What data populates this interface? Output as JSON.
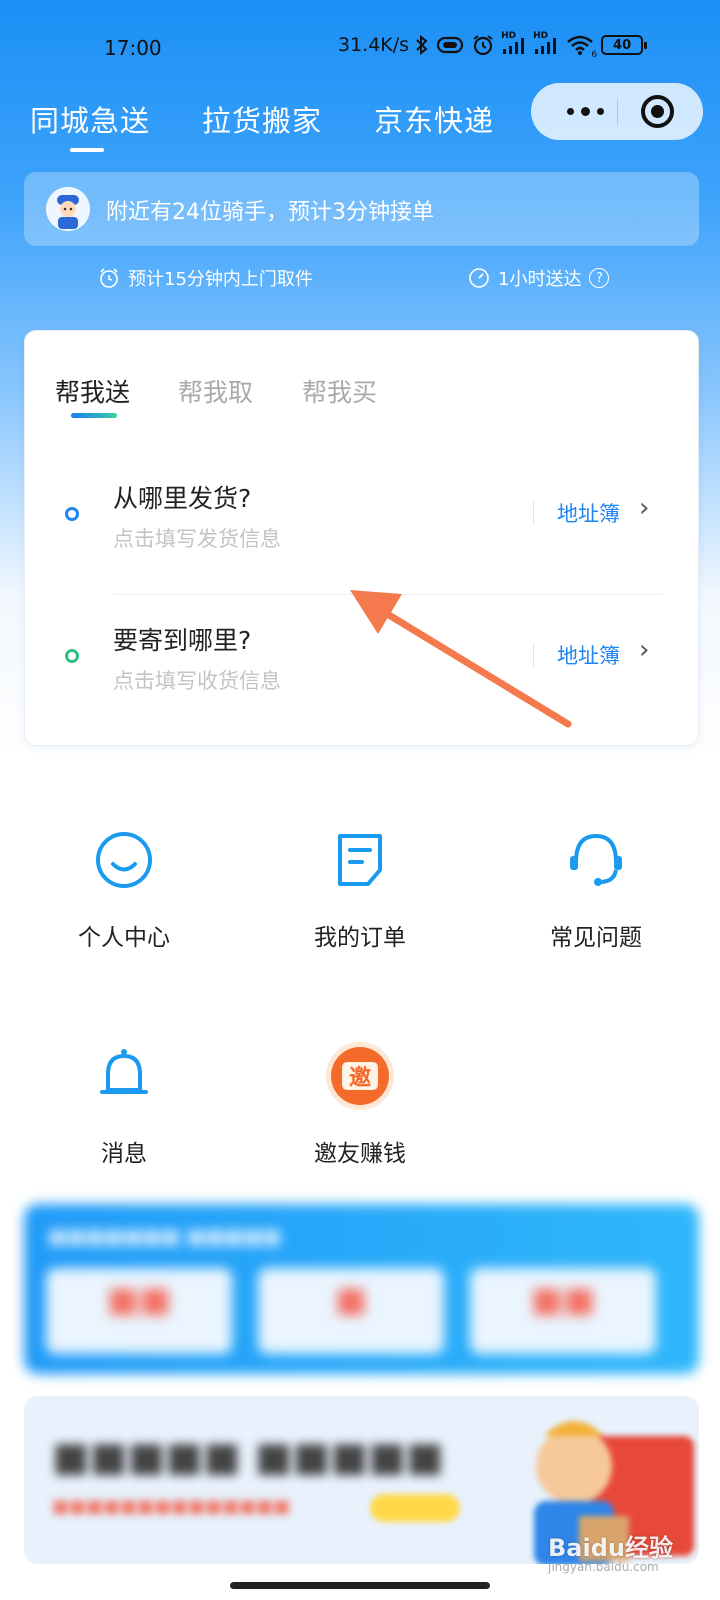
{
  "status_bar": {
    "time": "17:00",
    "net_speed": "31.4K/s",
    "hd1": "HD",
    "hd2": "HD",
    "wifi_sub": "6",
    "battery": "40"
  },
  "top_tabs": [
    {
      "label": "同城急送",
      "active": true
    },
    {
      "label": "拉货搬家",
      "active": false
    },
    {
      "label": "京东快递",
      "active": false
    }
  ],
  "rider_banner": {
    "text": "附近有24位骑手，预计3分钟接单"
  },
  "eta": {
    "pickup": "预计15分钟内上门取件",
    "delivery": "1小时送达",
    "help_glyph": "?"
  },
  "card": {
    "tabs": [
      {
        "label": "帮我送",
        "active": true
      },
      {
        "label": "帮我取",
        "active": false
      },
      {
        "label": "帮我买",
        "active": false
      }
    ],
    "sender": {
      "title": "从哪里发货?",
      "hint": "点击填写发货信息",
      "book": "地址簿"
    },
    "receiver": {
      "title": "要寄到哪里?",
      "hint": "点击填写收货信息",
      "book": "地址簿"
    }
  },
  "menu": [
    {
      "label": "个人中心",
      "icon": "smile-icon"
    },
    {
      "label": "我的订单",
      "icon": "order-icon"
    },
    {
      "label": "常见问题",
      "icon": "headset-icon"
    },
    {
      "label": "消息",
      "icon": "bell-icon"
    },
    {
      "label": "邀友赚钱",
      "icon": "invite-badge-icon",
      "badge_text": "邀"
    }
  ],
  "colors": {
    "accent_blue": "#1e86f0",
    "green_dot": "#2fbf86",
    "annotation_orange": "#f47a4d",
    "invite_orange": "#f36a2a"
  },
  "watermark": {
    "logo": "Baidu经验",
    "url": "jingyan.baidu.com"
  }
}
